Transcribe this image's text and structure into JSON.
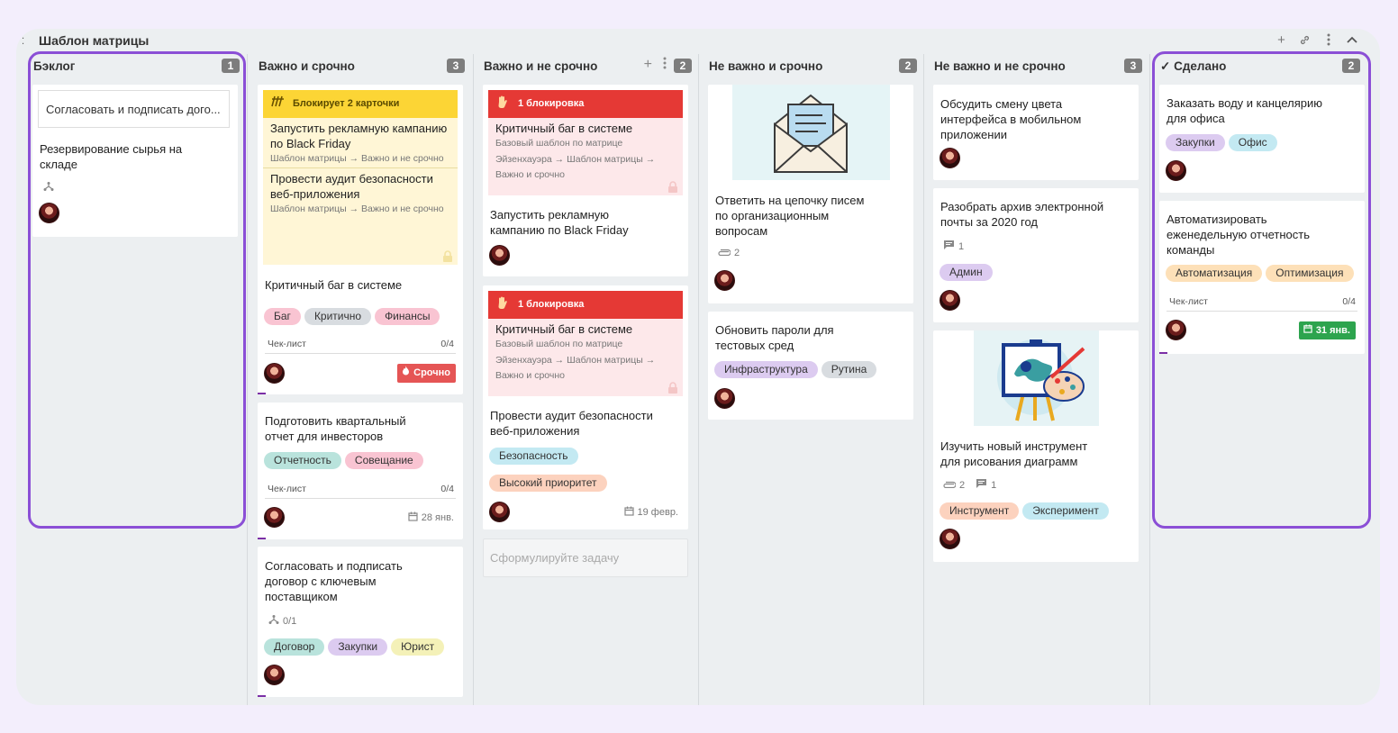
{
  "board": {
    "title": "Шаблон матрицы",
    "icons": [
      "plus-icon",
      "link-icon",
      "more-icon",
      "collapse-icon"
    ]
  },
  "columns": [
    {
      "title": "Бэклог",
      "count": "1"
    },
    {
      "title": "Важно и срочно",
      "count": "3"
    },
    {
      "title": "Важно и не срочно",
      "count": "2"
    },
    {
      "title": "Не важно и срочно",
      "count": "2"
    },
    {
      "title": "Не важно и не срочно",
      "count": "3"
    },
    {
      "title": "Сделано",
      "count": "2",
      "check": "✓"
    }
  ],
  "backlog": {
    "input_value": "Согласовать и подписать дого...",
    "card1": {
      "title": "Резервирование сырья на складе"
    }
  },
  "urgent": {
    "card1": {
      "banner": "Блокирует 2 карточки",
      "sub1_title": "Запустить рекламную кампанию по Black Friday",
      "sub1_path": "Шаблон матрицы → Важно и не срочно",
      "sub2_title": "Провести аудит безопасности веб-приложения",
      "sub2_path": "Шаблон матрицы → Важно и не срочно",
      "title": "Критичный баг в системе",
      "tags": [
        "Баг",
        "Критично",
        "Финансы"
      ],
      "checklist_label": "Чек-лист",
      "checklist_value": "0/4",
      "due_label": "Срочно"
    },
    "card2": {
      "title": "Подготовить квартальный отчет для инвесторов",
      "tags": [
        "Отчетность",
        "Совещание"
      ],
      "checklist_label": "Чек-лист",
      "checklist_value": "0/4",
      "due": "28 янв."
    },
    "card3": {
      "title": "Согласовать и подписать договор с ключевым поставщиком",
      "subtasks": "0/1",
      "tags": [
        "Договор",
        "Закупки",
        "Юрист"
      ]
    }
  },
  "important": {
    "card1": {
      "banner": "1 блокировка",
      "sub_title": "Критичный баг в системе",
      "sub_path": "Базовый шаблон по матрице Эйзенхауэра → Шаблон матрицы → Важно и срочно",
      "title": "Запустить рекламную кампанию по Black Friday"
    },
    "card2": {
      "banner": "1 блокировка",
      "sub_title": "Критичный баг в системе",
      "sub_path": "Базовый шаблон по матрице Эйзенхауэра → Шаблон матрицы → Важно и срочно",
      "title": "Провести аудит безопасности веб-приложения",
      "tags": [
        "Безопасность",
        "Высокий приоритет"
      ],
      "due": "19 февр."
    },
    "add_placeholder": "Сформулируйте задачу"
  },
  "notimportant_urgent": {
    "card1": {
      "title": "Ответить на цепочку писем по организационным вопросам",
      "attachments": "2"
    },
    "card2": {
      "title": "Обновить пароли для тестовых сред",
      "tags": [
        "Инфраструктура",
        "Рутина"
      ]
    }
  },
  "notimportant_noturgent": {
    "card1": {
      "title": "Обсудить смену цвета интерфейса в мобильном приложении"
    },
    "card2": {
      "title": "Разобрать архив электронной почты за 2020 год",
      "comments": "1",
      "tags": [
        "Админ"
      ]
    },
    "card3": {
      "title": "Изучить новый инструмент для рисования диаграмм",
      "attachments": "2",
      "comments": "1",
      "tags": [
        "Инструмент",
        "Эксперимент"
      ]
    }
  },
  "done": {
    "card1": {
      "title": "Заказать воду и канцелярию для офиса",
      "tags": [
        "Закупки",
        "Офис"
      ]
    },
    "card2": {
      "title": "Автоматизировать еженедельную отчетность команды",
      "tags": [
        "Автоматизация",
        "Оптимизация"
      ],
      "checklist_label": "Чек-лист",
      "checklist_value": "0/4",
      "due": "31 янв."
    }
  },
  "colors": {
    "highlight": "#8b4fd6",
    "yellow_banner": "#fcd535",
    "red_banner": "#e53935",
    "due_green": "#2da44e",
    "due_red": "#e55555"
  }
}
